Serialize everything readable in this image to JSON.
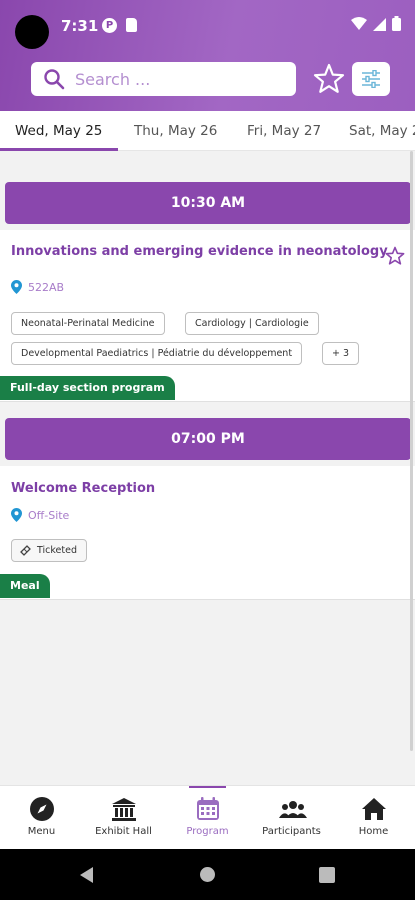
{
  "status_bar": {
    "time": "7:31",
    "app_icon": "P"
  },
  "search": {
    "placeholder": "Search ..."
  },
  "date_tabs": [
    {
      "label": "Wed, May 25",
      "active": true
    },
    {
      "label": "Thu, May 26",
      "active": false
    },
    {
      "label": "Fri, May 27",
      "active": false
    },
    {
      "label": "Sat, May 2",
      "active": false
    }
  ],
  "sessions": [
    {
      "time": "10:30 AM",
      "title": "Innovations and emerging evidence in neonatology",
      "location": "522AB",
      "chips": [
        "Neonatal-Perinatal Medicine",
        "Cardiology | Cardiologie",
        "Developmental Paediatrics | Pédiatrie du développement",
        "+ 3"
      ],
      "tag": "Full-day section program"
    },
    {
      "time": "07:00 PM",
      "title": "Welcome Reception",
      "location": "Off-Site",
      "chips": [
        "Ticketed"
      ],
      "tag": "Meal"
    }
  ],
  "bottom_nav": [
    {
      "label": "Menu",
      "icon": "compass-icon",
      "active": false
    },
    {
      "label": "Exhibit Hall",
      "icon": "building-icon",
      "active": false
    },
    {
      "label": "Program",
      "icon": "calendar-icon",
      "active": true
    },
    {
      "label": "Participants",
      "icon": "people-icon",
      "active": false
    },
    {
      "label": "Home",
      "icon": "home-icon",
      "active": false
    }
  ],
  "colors": {
    "brand": "#8a47ad",
    "tag_green": "#1a7f47",
    "link": "#a87cc9"
  }
}
